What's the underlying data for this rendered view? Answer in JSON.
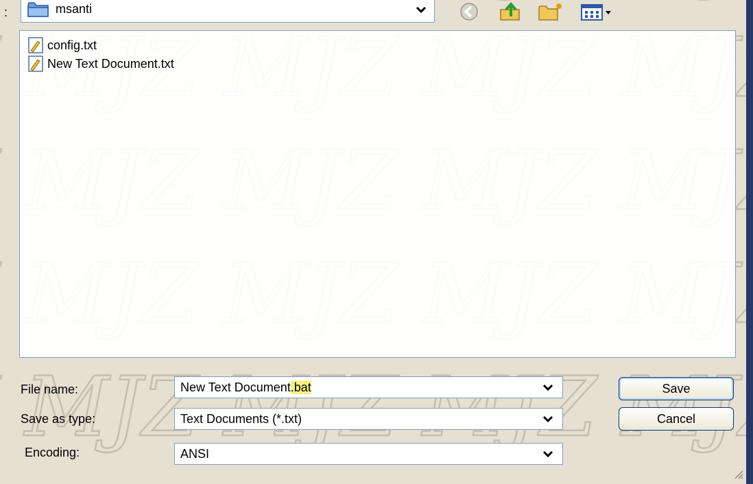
{
  "lookin": {
    "current_folder": "msanti",
    "separator": ":"
  },
  "files": [
    {
      "name": "config.txt"
    },
    {
      "name": "New Text Document.txt"
    }
  ],
  "form": {
    "file_name_label": "File name:",
    "file_name_value": "New Text Document",
    "file_name_ext": ".bat",
    "save_type_label": "Save as type:",
    "save_type_value": "Text Documents (*.txt)",
    "encoding_label": "Encoding:",
    "encoding_value": "ANSI"
  },
  "buttons": {
    "save": "Save",
    "cancel": "Cancel"
  },
  "colors": {
    "accent_border": "#7f9db9",
    "button_border": "#003c74",
    "highlight": "#f4f383",
    "window_edge": "#273a66"
  },
  "icons": [
    "folder-icon",
    "back-icon",
    "up-folder-icon",
    "new-folder-icon",
    "view-menu-icon",
    "text-file-icon",
    "chevron-down-icon",
    "resize-grip-icon"
  ]
}
